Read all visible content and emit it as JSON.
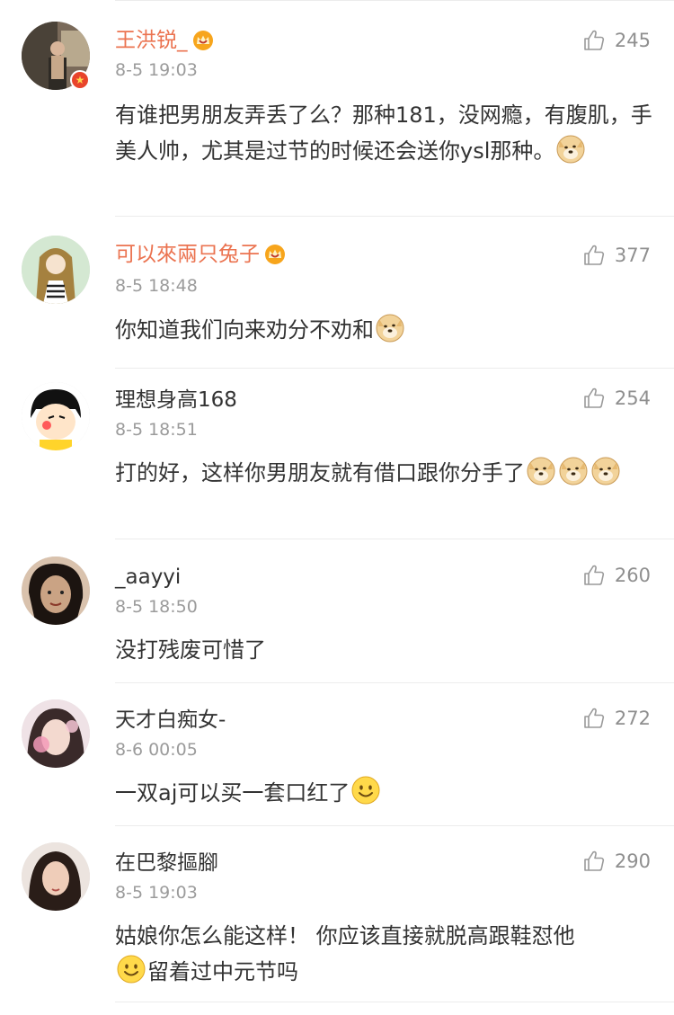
{
  "comments": [
    {
      "username": "王洪锐_",
      "time": "8-5 19:03",
      "likes": "245",
      "content_1": "有谁把男朋友弄丢了么？那种181，没网瘾，有腹肌，手美人帅，尤其是过节的时候还会送你ysl那种。",
      "content_2": ""
    },
    {
      "username": "可以來兩只兔子",
      "time": "8-5 18:48",
      "likes": "377",
      "content_1": "你知道我们向来劝分不劝和",
      "content_2": ""
    },
    {
      "username": "理想身高168",
      "time": "8-5 18:51",
      "likes": "254",
      "content_1": "打的好，这样你男朋友就有借口跟你分手了",
      "content_2": ""
    },
    {
      "username": "_aayyi",
      "time": "8-5 18:50",
      "likes": "260",
      "content_1": "没打残废可惜了",
      "content_2": ""
    },
    {
      "username": "天才白痴女-",
      "time": "8-6 00:05",
      "likes": "272",
      "content_1": "一双aj可以买一套口红了",
      "content_2": ""
    },
    {
      "username": "在巴黎摳腳",
      "time": "8-5 19:03",
      "likes": "290",
      "content_1": "姑娘你怎么能这样！ 你应该直接就脱高跟鞋怼他",
      "content_2": "留着过中元节吗"
    }
  ],
  "icons": {
    "like": "thumbs-up-icon",
    "crown": "vip-crown-icon",
    "doge": "doge-emoji",
    "smile": "smile-emoji"
  },
  "colors": {
    "vip_name": "#eb7350",
    "name": "#333333",
    "time": "#9b9b9b",
    "like": "#8f8f8f"
  }
}
